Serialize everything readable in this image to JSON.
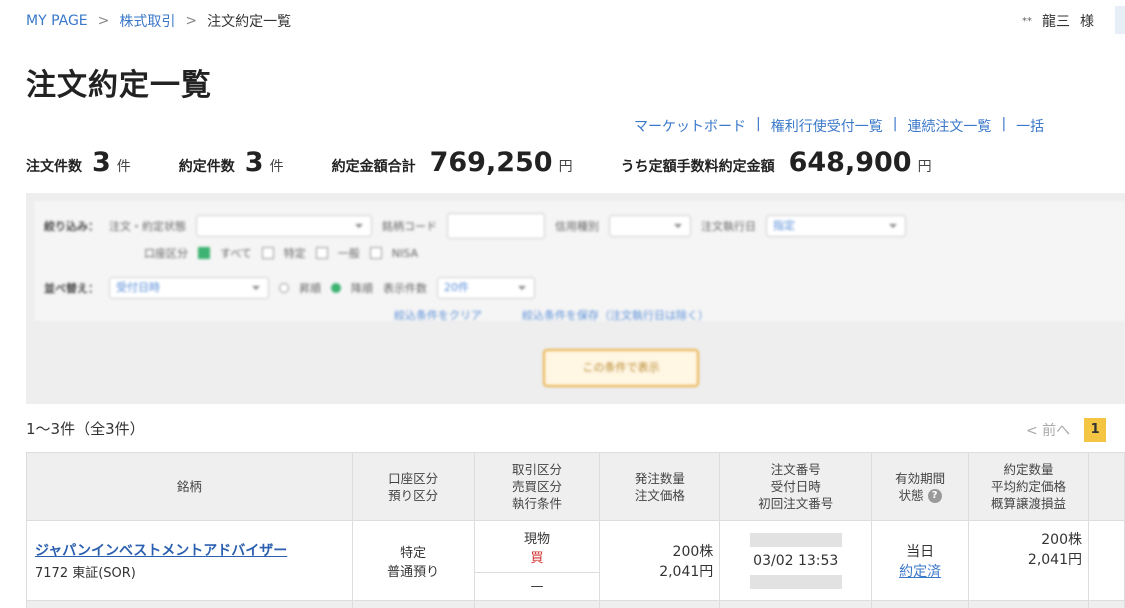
{
  "breadcrumb": {
    "home": "MY PAGE",
    "sep": ">",
    "section": "株式取引",
    "current": "注文約定一覧"
  },
  "user": {
    "stars": "**",
    "name": "龍三",
    "honorific": "様"
  },
  "page_title": "注文約定一覧",
  "links": [
    "マーケットボード",
    "権利行使受付一覧",
    "連続注文一覧",
    "一括"
  ],
  "links_sep": "|",
  "summary": {
    "order_count_label": "注文件数",
    "order_count": "3",
    "order_count_unit": "件",
    "exec_count_label": "約定件数",
    "exec_count": "3",
    "exec_count_unit": "件",
    "exec_total_label": "約定金額合計",
    "exec_total": "769,250",
    "exec_total_unit": "円",
    "fixed_fee_label": "うち定額手数料約定金額",
    "fixed_fee": "648,900",
    "fixed_fee_unit": "円"
  },
  "results": {
    "count_text": "1〜3件（全3件）",
    "prev": "< 前へ",
    "page": "1"
  },
  "filter": {
    "narrow": "絞り込み：",
    "status_label": "注文・約定状態",
    "code_label": "銘柄コード",
    "credit_label": "信用種別",
    "date_label": "注文執行日",
    "date_value": "指定",
    "account_label": "口座区分",
    "account_opts": [
      "すべて",
      "特定",
      "一般",
      "NISA"
    ],
    "sort": "並べ替え：",
    "sort_value": "受付日時",
    "asc": "昇順",
    "desc": "降順",
    "display_label": "表示件数",
    "display_value": "20件",
    "clear": "絞込条件をクリア",
    "save": "絞込条件を保存（注文執行日は除く）",
    "show_button": "この条件で表示"
  },
  "table": {
    "headers": [
      [
        "銘柄"
      ],
      [
        "口座区分",
        "預り区分"
      ],
      [
        "取引区分",
        "売買区分",
        "執行条件"
      ],
      [
        "発注数量",
        "注文価格"
      ],
      [
        "注文番号",
        "受付日時",
        "初回注文番号"
      ],
      [
        "有効期間",
        "状態"
      ],
      [
        "約定数量",
        "平均約定価格",
        "概算譲渡損益"
      ]
    ],
    "row": {
      "name": "ジャパンインベストメントアドバイザー",
      "code": "7172 東証(SOR)",
      "account": "特定",
      "custody": "普通預り",
      "trade_type": "現物",
      "side": "買",
      "condition": "—",
      "qty": "200株",
      "price": "2,041円",
      "received": "03/02 13:53",
      "period": "当日",
      "status": "約定済",
      "exec_qty": "200株",
      "avg_price": "2,041円"
    }
  },
  "colors": {
    "link": "#3a78c9",
    "buy": "#d0312d",
    "highlight": "#f4c542",
    "header_bg": "#efefef"
  }
}
